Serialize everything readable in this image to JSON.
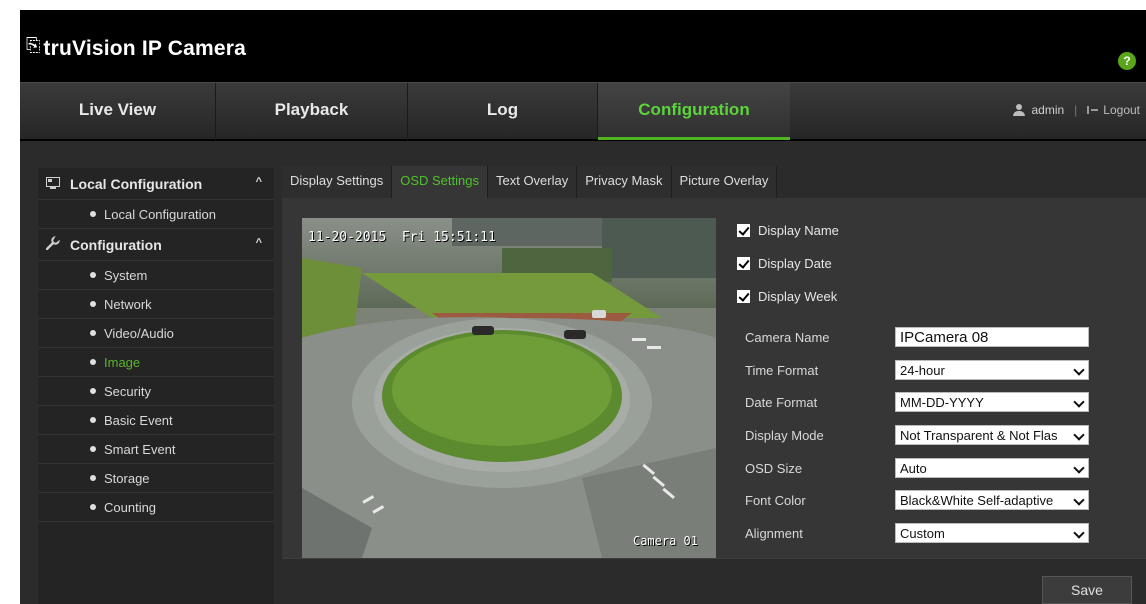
{
  "app": {
    "logo_text": "truVision IP Camera",
    "help_label": "?"
  },
  "nav": {
    "tabs": [
      {
        "label": "Live View"
      },
      {
        "label": "Playback"
      },
      {
        "label": "Log"
      },
      {
        "label": "Configuration",
        "active": true
      }
    ],
    "user": "admin",
    "separator": "|",
    "logout": "Logout"
  },
  "sidebar": {
    "sections": [
      {
        "label": "Local Configuration",
        "icon": "monitor-icon",
        "items": [
          "Local Configuration"
        ]
      },
      {
        "label": "Configuration",
        "icon": "wrench-icon",
        "items": [
          "System",
          "Network",
          "Video/Audio",
          "Image",
          "Security",
          "Basic Event",
          "Smart Event",
          "Storage",
          "Counting"
        ]
      }
    ],
    "active_item": "Image"
  },
  "tabs": [
    {
      "label": "Display Settings"
    },
    {
      "label": "OSD Settings",
      "active": true
    },
    {
      "label": "Text Overlay"
    },
    {
      "label": "Privacy Mask"
    },
    {
      "label": "Picture Overlay"
    }
  ],
  "video": {
    "osd_datetime": "11-20-2015  Fri 15:51:11",
    "osd_camera_name": "Camera 01"
  },
  "osd": {
    "checkboxes": [
      {
        "label": "Display Name",
        "checked": true
      },
      {
        "label": "Display Date",
        "checked": true
      },
      {
        "label": "Display Week",
        "checked": true
      }
    ],
    "fields": [
      {
        "label": "Camera Name",
        "value": "IPCamera 08",
        "type": "text"
      },
      {
        "label": "Time Format",
        "value": "24-hour",
        "type": "select"
      },
      {
        "label": "Date Format",
        "value": "MM-DD-YYYY",
        "type": "select"
      },
      {
        "label": "Display Mode",
        "value": "Not Transparent & Not Flas",
        "type": "select"
      },
      {
        "label": "OSD Size",
        "value": "Auto",
        "type": "select"
      },
      {
        "label": "Font Color",
        "value": "Black&White Self-adaptive",
        "type": "select"
      },
      {
        "label": "Alignment",
        "value": "Custom",
        "type": "select"
      }
    ]
  },
  "footer": {
    "save_label": "Save"
  },
  "colors": {
    "accent": "#4fc12c",
    "nav_bg": "#2f2f2f",
    "panel_bg": "#363636"
  }
}
